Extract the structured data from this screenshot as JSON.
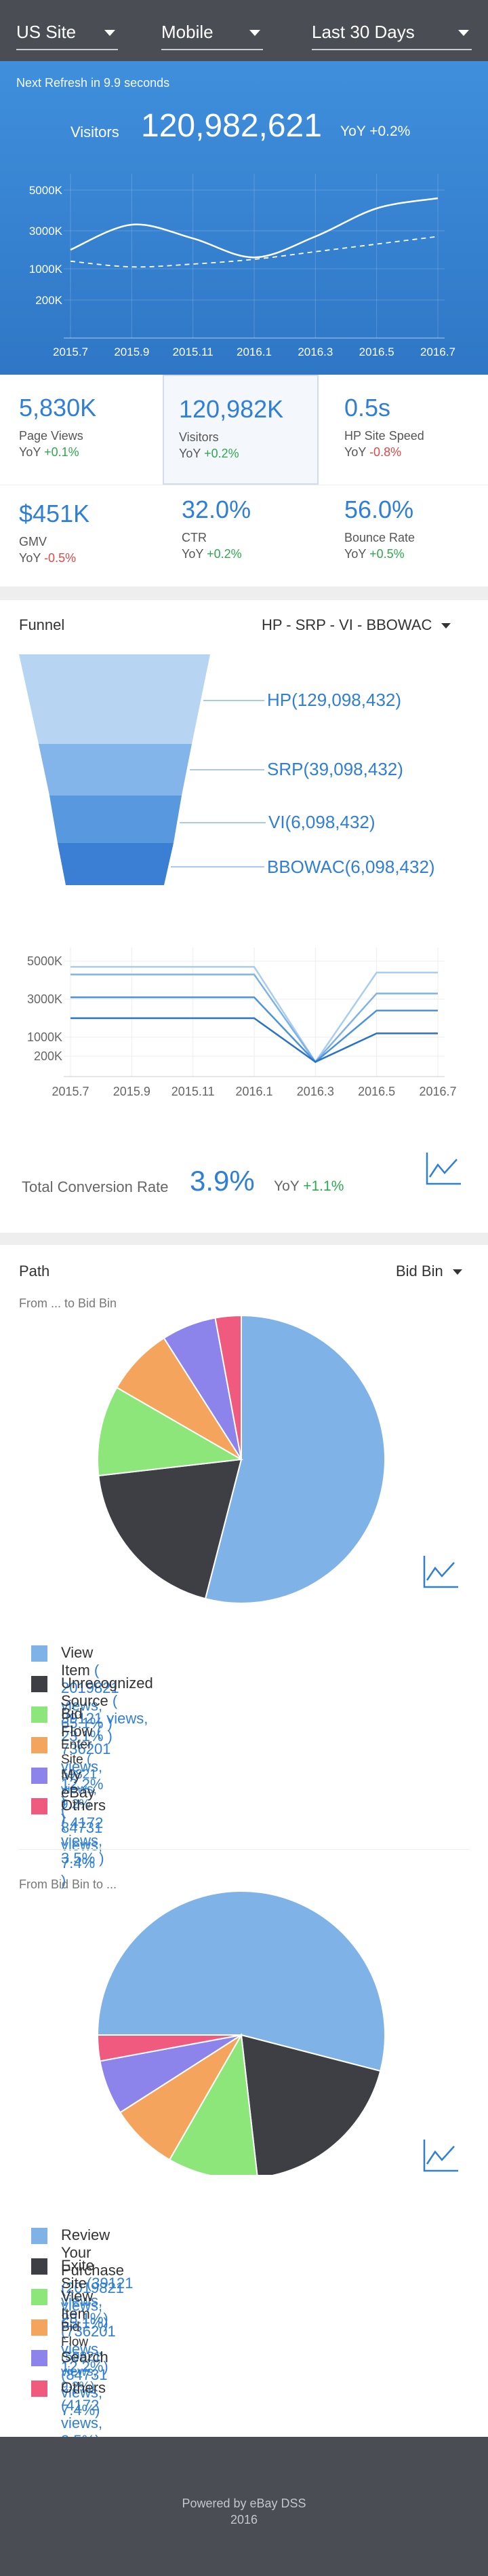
{
  "header": {
    "site": "US Site",
    "device": "Mobile",
    "range": "Last 30 Days"
  },
  "hero": {
    "refresh": "Next Refresh in 9.9 seconds",
    "visitors_label": "Visitors",
    "visitors_value": "120,982,621",
    "yoy": "YoY +0.2%"
  },
  "kpis": [
    {
      "value": "5,830K",
      "name": "Page Views",
      "yoy_label": "YoY",
      "yoy": "+0.1%",
      "trend": "up"
    },
    {
      "value": "120,982K",
      "name": "Visitors",
      "yoy_label": "YoY",
      "yoy": "+0.2%",
      "trend": "up"
    },
    {
      "value": "0.5s",
      "name": "HP Site Speed",
      "yoy_label": "YoY",
      "yoy": "-0.8%",
      "trend": "down"
    },
    {
      "value": "$451K",
      "name": "GMV",
      "yoy_label": "YoY",
      "yoy": "-0.5%",
      "trend": "down"
    },
    {
      "value": "32.0%",
      "name": "CTR",
      "yoy_label": "YoY",
      "yoy": "+0.2%",
      "trend": "up"
    },
    {
      "value": "56.0%",
      "name": "Bounce Rate",
      "yoy_label": "YoY",
      "yoy": "+0.5%",
      "trend": "up"
    }
  ],
  "funnel": {
    "title": "Funnel",
    "selector": "HP - SRP - VI - BBOWAC",
    "stages": [
      "HP(129,098,432)",
      "SRP(39,098,432)",
      "VI(6,098,432)",
      "BBOWAC(6,098,432)"
    ],
    "conversion_label": "Total Conversion Rate",
    "conversion_value": "3.9%",
    "conversion_yoy_label": "YoY",
    "conversion_yoy": "+1.1%"
  },
  "path": {
    "title": "Path",
    "selector": "Bid Bin",
    "from_title": "From ... to Bid Bin",
    "to_title": "From Bid Bin to ...",
    "from_items": [
      {
        "name": "View Item",
        "detail": "( 2019821 views, 65.1% )",
        "color": "#7fb3e8"
      },
      {
        "name": "Unrecognized Source",
        "detail": "( 39121 views, 23.1% )",
        "color": "#3d3f45"
      },
      {
        "name": "Bid Flow",
        "detail": "( 736201 views, 12.2% )",
        "color": "#8ce67a"
      },
      {
        "name": "Enter Site",
        "detail": "( 59821 views, 9.2% )",
        "color": "#f4a45c"
      },
      {
        "name": "My eBay",
        "detail": "( 84731 views, 7.4% )",
        "color": "#8c84ea"
      },
      {
        "name": "Others",
        "detail": "( 4172 views, 3.5% )",
        "color": "#f05a7e"
      }
    ],
    "to_items": [
      {
        "name": "Review Your Purchase",
        "detail": "(2019821 views, 65.1%)",
        "color": "#7fb3e8"
      },
      {
        "name": "Exite Site",
        "detail": "(39121 views, 23.1%)",
        "color": "#3d3f45"
      },
      {
        "name": "View Item",
        "detail": "(736201 views, 12.2%)",
        "color": "#8ce67a"
      },
      {
        "name": "Bid Flow",
        "detail": "(59821 views, 9.2%)",
        "color": "#f4a45c"
      },
      {
        "name": "Search",
        "detail": "(84731 views, 7.4%)",
        "color": "#8c84ea"
      },
      {
        "name": "Others",
        "detail": "(4172 views, 3.5%)",
        "color": "#f05a7e"
      }
    ]
  },
  "footer": {
    "line1": "Powered by eBay DSS",
    "line2": "2016"
  },
  "chart_data": [
    {
      "type": "line",
      "x": [
        "2015.7",
        "2015.9",
        "2015.11",
        "2016.1",
        "2016.3",
        "2016.5",
        "2016.7"
      ],
      "yticks": [
        "5000K",
        "3000K",
        "1000K",
        "200K"
      ],
      "series": [
        {
          "values": [
            2000,
            3300,
            2600,
            1600,
            2700,
            4100,
            4600
          ],
          "style": "solid"
        },
        {
          "values": [
            1400,
            1100,
            1250,
            1500,
            1900,
            2300,
            2700
          ],
          "style": "dashed"
        }
      ]
    },
    {
      "type": "line",
      "x": [
        "2015.7",
        "2015.9",
        "2015.11",
        "2016.1",
        "2016.3",
        "2016.5",
        "2016.7"
      ],
      "yticks": [
        "5000K",
        "3000K",
        "1000K",
        "200K"
      ],
      "series": [
        {
          "values": [
            4700,
            4700,
            4700,
            4700,
            0,
            4400,
            4400
          ]
        },
        {
          "values": [
            4300,
            4300,
            4300,
            4300,
            0,
            3300,
            3300
          ]
        },
        {
          "values": [
            3100,
            3100,
            3100,
            3100,
            0,
            2400,
            2400
          ]
        },
        {
          "values": [
            2000,
            2000,
            2000,
            2000,
            0,
            1200,
            1200
          ]
        }
      ]
    },
    {
      "type": "pie",
      "title": "From ... to Bid Bin",
      "labels": [
        "View Item",
        "Unrecognized Source",
        "Bid Flow",
        "Enter Site",
        "My eBay",
        "Others"
      ],
      "values": [
        65.1,
        23.1,
        12.2,
        9.2,
        7.4,
        3.5
      ]
    },
    {
      "type": "pie",
      "title": "From Bid Bin to ...",
      "labels": [
        "Review Your Purchase",
        "Exite Site",
        "View Item",
        "Bid Flow",
        "Search",
        "Others"
      ],
      "values": [
        65.1,
        23.1,
        12.2,
        9.2,
        7.4,
        3.5
      ]
    }
  ]
}
